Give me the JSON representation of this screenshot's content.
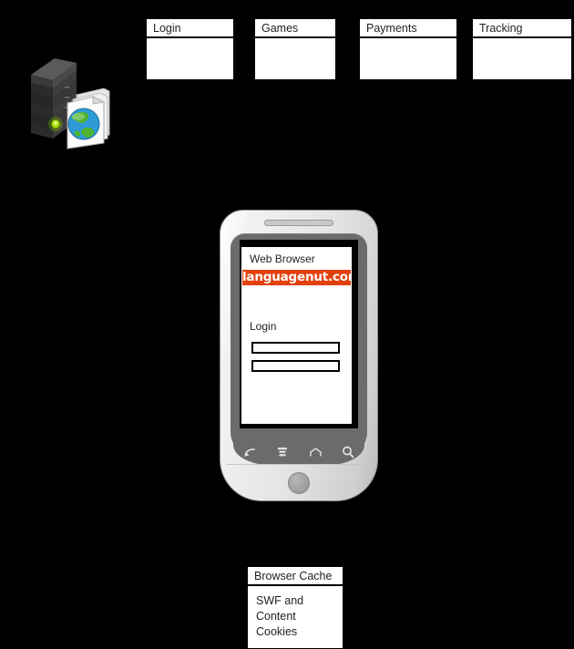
{
  "diagram": {
    "title_boxes": [
      {
        "id": "login",
        "title": "Login",
        "body": ""
      },
      {
        "id": "games",
        "title": "Games",
        "body": ""
      },
      {
        "id": "payments",
        "title": "Payments",
        "body": ""
      },
      {
        "id": "tracking",
        "title": "Tracking",
        "body": ""
      }
    ],
    "server": {
      "icon": "server-rack-icon",
      "documents_icon": "web-documents-globe-icon"
    },
    "phone": {
      "device_icon": "smartphone-icon",
      "browser_title": "Web Browser",
      "site_logo_text": "languagenut.com",
      "site_logo_color": "#e2400d",
      "login_heading": "Login",
      "fields": [
        {
          "name": "username-field",
          "value": "",
          "placeholder": ""
        },
        {
          "name": "password-field",
          "value": "",
          "placeholder": ""
        }
      ],
      "nav_buttons": [
        {
          "name": "back-icon"
        },
        {
          "name": "menu-icon"
        },
        {
          "name": "home-icon"
        },
        {
          "name": "search-icon"
        }
      ],
      "home_button": "home-button"
    },
    "cache_box": {
      "title": "Browser Cache",
      "lines": [
        "SWF and",
        "Content",
        "Cookies"
      ]
    }
  }
}
